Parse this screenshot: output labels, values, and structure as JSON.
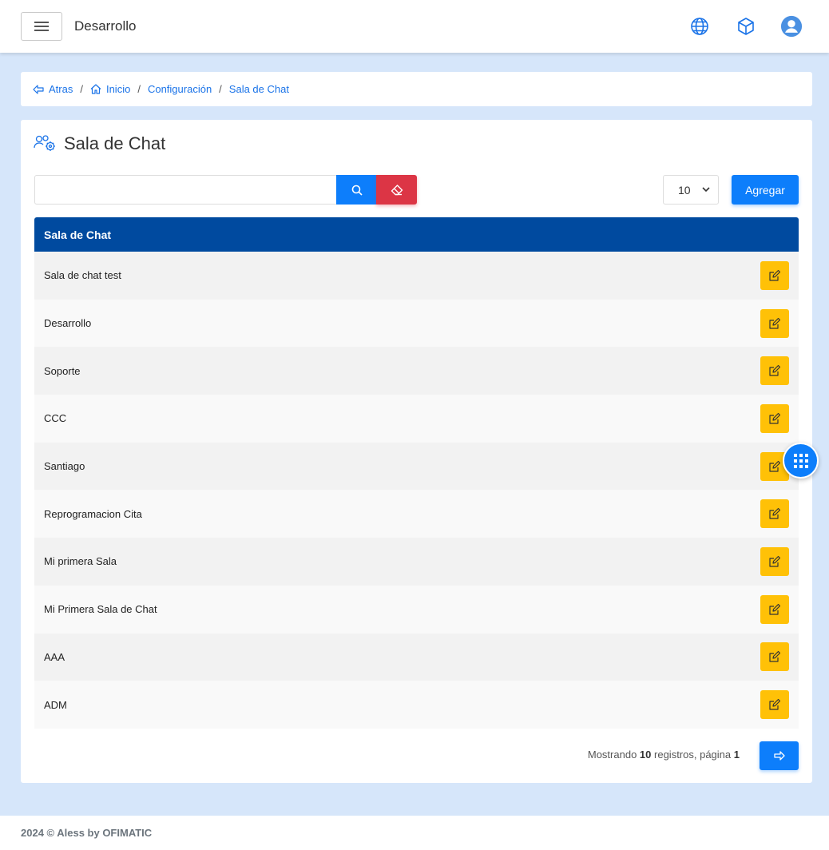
{
  "navbar": {
    "title": "Desarrollo",
    "icons": [
      "menu-icon",
      "globe-icon",
      "box-icon",
      "user-icon"
    ],
    "accent": "#0d7efb"
  },
  "breadcrumb": {
    "back": "Atras",
    "home": "Inicio",
    "config": "Configuración",
    "current": "Sala de Chat"
  },
  "page": {
    "title": "Sala de Chat",
    "search_placeholder": "",
    "page_size": "10",
    "add_label": "Agregar"
  },
  "table": {
    "header": "Sala de Chat",
    "rows": [
      "Sala de chat test",
      "Desarrollo",
      "Soporte",
      "CCC",
      "Santiago",
      "Reprogramacion Cita",
      "Mi primera Sala",
      "Mi Primera Sala de Chat",
      "AAA",
      "ADM"
    ]
  },
  "pagination": {
    "prefix": "Mostrando",
    "count": "10",
    "middle": "registros, página",
    "page": "1"
  },
  "footer": {
    "text": "2024 © Aless by OFIMATIC"
  },
  "colors": {
    "primary": "#0d7efb",
    "danger": "#dc3545",
    "warning": "#ffc107",
    "table_header": "#004a9f",
    "background": "#d6e6fa"
  }
}
